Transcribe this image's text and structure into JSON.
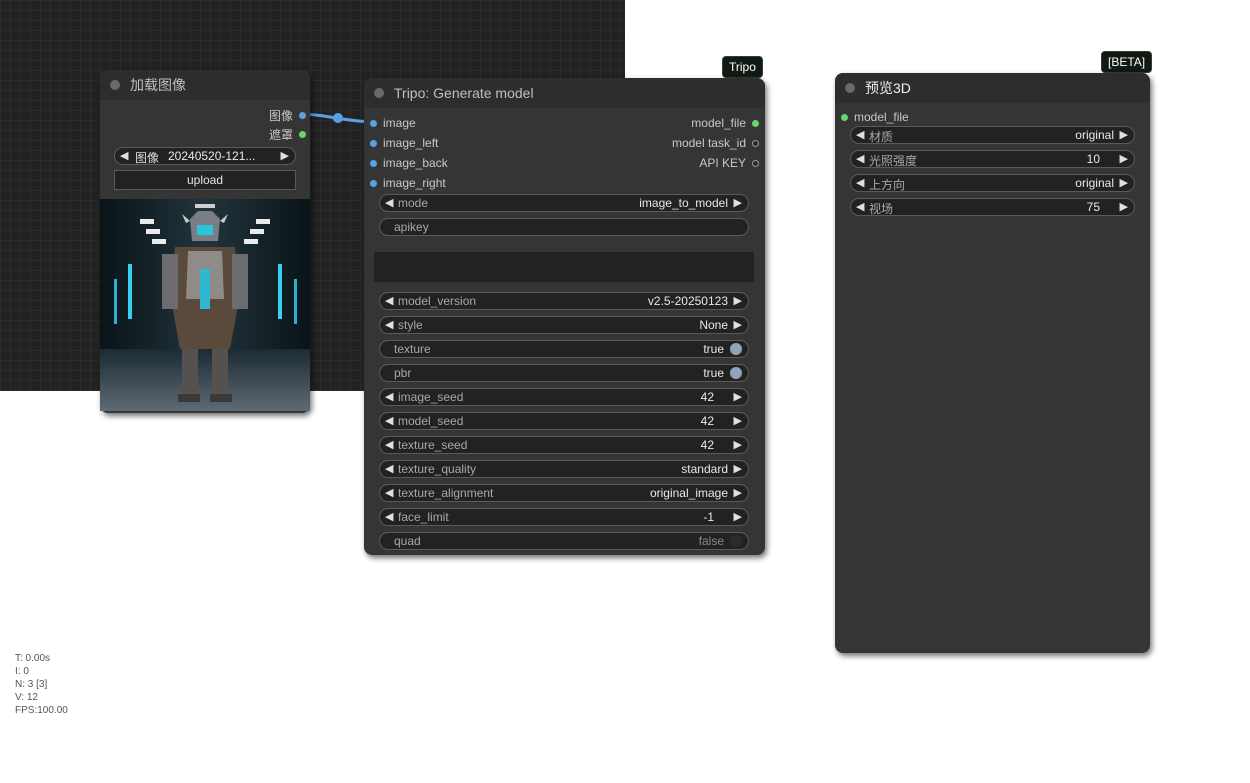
{
  "load_image_node": {
    "title": "加载图像",
    "outputs": [
      "图像",
      "遮罩"
    ],
    "image_combo": {
      "label": "图像",
      "value": "20240520-121..."
    },
    "upload_label": "upload"
  },
  "tripo_node": {
    "badge": "Tripo",
    "title": "Tripo: Generate model",
    "inputs": [
      "image",
      "image_left",
      "image_back",
      "image_right"
    ],
    "outputs": [
      "model_file",
      "model task_id",
      "API KEY"
    ],
    "mode": {
      "label": "mode",
      "value": "image_to_model"
    },
    "apikey_label": "apikey",
    "model_version": {
      "label": "model_version",
      "value": "v2.5-20250123"
    },
    "style": {
      "label": "style",
      "value": "None"
    },
    "texture": {
      "label": "texture",
      "value": "true"
    },
    "pbr": {
      "label": "pbr",
      "value": "true"
    },
    "image_seed": {
      "label": "image_seed",
      "value": "42"
    },
    "model_seed": {
      "label": "model_seed",
      "value": "42"
    },
    "texture_seed": {
      "label": "texture_seed",
      "value": "42"
    },
    "texture_quality": {
      "label": "texture_quality",
      "value": "standard"
    },
    "texture_alignment": {
      "label": "texture_alignment",
      "value": "original_image"
    },
    "face_limit": {
      "label": "face_limit",
      "value": "-1"
    },
    "quad": {
      "label": "quad",
      "value": "false"
    }
  },
  "preview_node": {
    "badge": "[BETA]",
    "title": "预览3D",
    "input": "model_file",
    "material": {
      "label": "材质",
      "value": "original"
    },
    "light": {
      "label": "光照强度",
      "value": "10"
    },
    "up": {
      "label": "上方向",
      "value": "original"
    },
    "fov": {
      "label": "视场",
      "value": "75"
    }
  },
  "stats": {
    "t": "T: 0.00s",
    "i": "I: 0",
    "n": "N: 3 [3]",
    "v": "V: 12",
    "fps": "FPS:100.00"
  },
  "colors": {
    "link": "#5aa0e6",
    "output_green": "#69d867",
    "node_bg": "#353535",
    "canvas_bg": "#222222"
  },
  "icons": [
    "left-arrow-icon",
    "right-arrow-icon",
    "toggle-knob-icon"
  ]
}
